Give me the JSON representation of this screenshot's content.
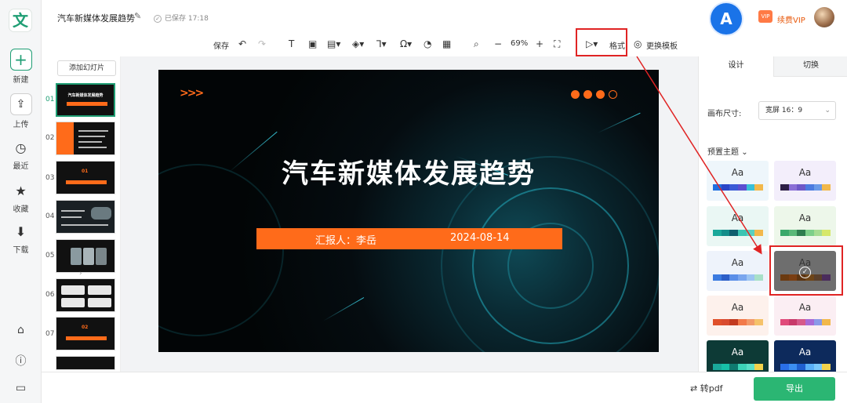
{
  "app": {
    "logo_glyph": "文",
    "doc_title": "汽车新媒体发展趋势",
    "saved_status": "已保存 17:18",
    "brand_glyph": "A",
    "vip_label": "续费VIP",
    "vip_badge": "VIP"
  },
  "leftnav": {
    "new": "新建",
    "upload": "上传",
    "recent": "最近",
    "favorite": "收藏",
    "download": "下载"
  },
  "toolbar": {
    "save": "保存",
    "zoom": "69%",
    "format": "格式",
    "change_template": "更换模板"
  },
  "thumbs": {
    "add_slide": "添加幻灯片",
    "numbers": [
      "01",
      "02",
      "03",
      "04",
      "05",
      "06",
      "07"
    ],
    "slide1_title": "汽车新媒体发展趋势",
    "slide3_num": "01",
    "slide7_num": "02"
  },
  "slide": {
    "title": "汽车新媒体发展趋势",
    "reporter": "汇报人：李岳",
    "date": "2024-08-14",
    "chevrons": ">>>"
  },
  "rpanel": {
    "tab_design": "设计",
    "tab_switch": "切换",
    "canvas_size_label": "画布尺寸:",
    "canvas_size_value": "宽屏 16：9",
    "preset_label": "预置主题",
    "theme_aa": "Aa"
  },
  "themes": [
    {
      "bg": "#eef6fb",
      "aa": "#333333",
      "colors": [
        "#1f6fe0",
        "#2a46c8",
        "#3b5bd6",
        "#5b4fd0",
        "#38c0d8",
        "#f2b84b"
      ]
    },
    {
      "bg": "#f3eefb",
      "aa": "#333333",
      "colors": [
        "#2d1f46",
        "#8b6fd6",
        "#6e58c8",
        "#4c7be0",
        "#6a9ae8",
        "#f2b84b"
      ]
    },
    {
      "bg": "#eaf7f4",
      "aa": "#333333",
      "colors": [
        "#1aa89a",
        "#138d8a",
        "#0f5e6e",
        "#3cc4b2",
        "#5ad0c0",
        "#f2b84b"
      ]
    },
    {
      "bg": "#edf7ea",
      "aa": "#333333",
      "colors": [
        "#3aa86a",
        "#5ab878",
        "#2e7d4f",
        "#7dcf8a",
        "#a6dc92",
        "#d6e86a"
      ]
    },
    {
      "bg": "#eef3fb",
      "aa": "#333333",
      "colors": [
        "#3b7be0",
        "#2c5fc8",
        "#5b8fe8",
        "#7aa6ee",
        "#9cc4f2",
        "#a8e0c8"
      ]
    },
    {
      "bg": "#6e6e6e",
      "aa": "#333333",
      "colors": [
        "#6b3a10",
        "#7a3e12",
        "#5c3410",
        "#6e4518",
        "#5a3f2a",
        "#4a2c5c"
      ]
    },
    {
      "bg": "#fdf1ec",
      "aa": "#333333",
      "colors": [
        "#e0502a",
        "#d94a2e",
        "#c23a20",
        "#f27a4a",
        "#f29a6a",
        "#f5c26a"
      ]
    },
    {
      "bg": "#fbeef3",
      "aa": "#333333",
      "colors": [
        "#e04a7a",
        "#c83a6a",
        "#d65a8a",
        "#a86ad6",
        "#8a9ae8",
        "#f2b84b"
      ]
    },
    {
      "bg": "#0d3a36",
      "aa": "#ffffff",
      "colors": [
        "#1aa89a",
        "#17c0a8",
        "#0f7a70",
        "#3cd4b8",
        "#5ae0c8",
        "#f2d24b"
      ]
    },
    {
      "bg": "#0d2a5c",
      "aa": "#ffffff",
      "colors": [
        "#2a6fe8",
        "#3b8ef2",
        "#1f5fd0",
        "#5ab0f8",
        "#7ac8fa",
        "#f2d24b"
      ]
    }
  ],
  "bottombar": {
    "convert_pdf": "转pdf",
    "export": "导出"
  },
  "colors": {
    "brand_green": "#1f9e74",
    "export_green": "#2bb673",
    "slide_orange": "#ff6b1a",
    "highlight_red": "#e02424"
  }
}
